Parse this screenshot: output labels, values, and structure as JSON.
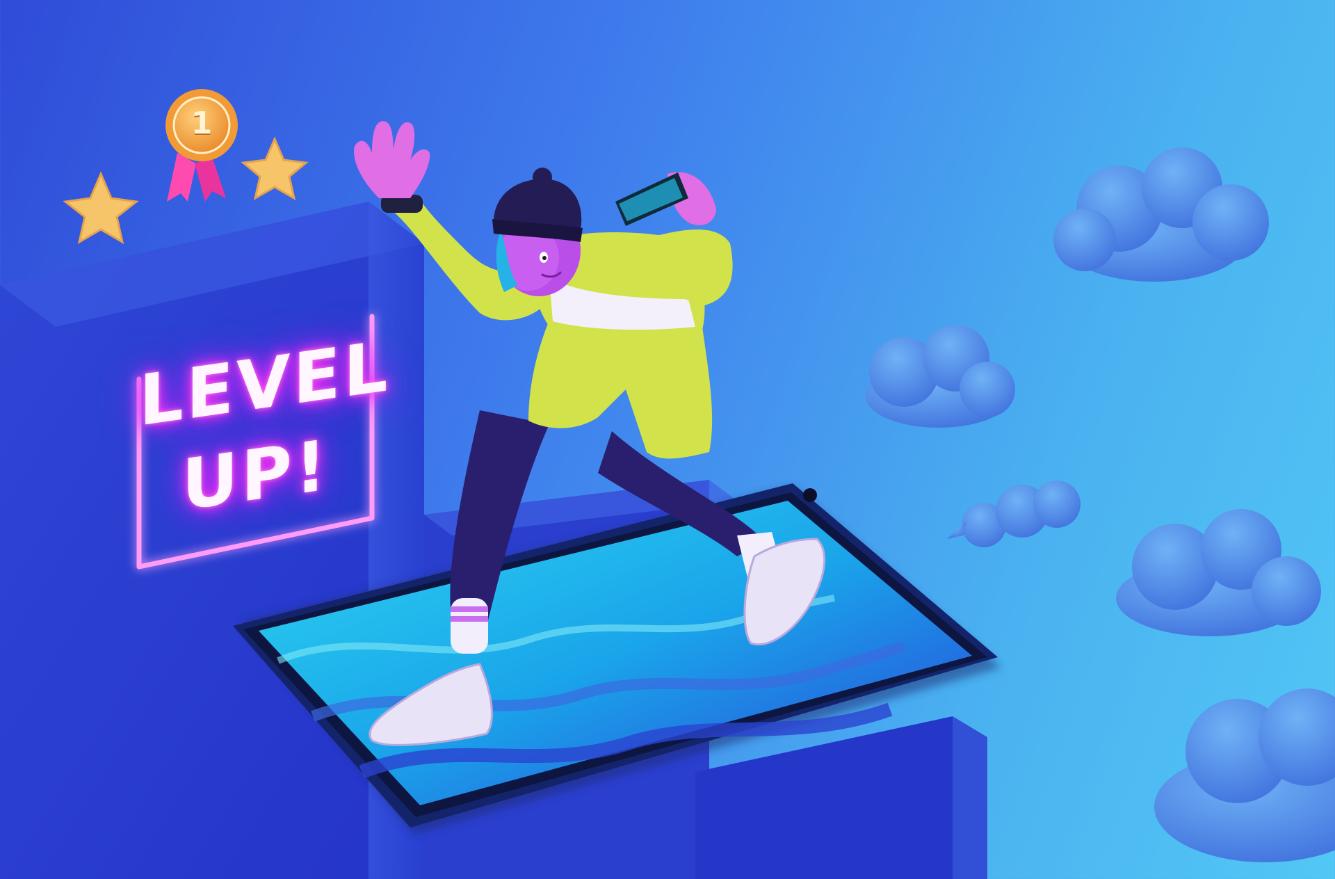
{
  "sign": {
    "line1": "LEVEL",
    "line2": "UP!"
  },
  "medal": {
    "number": "1"
  },
  "colors": {
    "background_left": "#2f4bd8",
    "background_right": "#52c7f5",
    "neon_pink": "#ff3ce8",
    "shirt_lime": "#d2e24a",
    "cloud_blue": "#4f8fe6",
    "screen_cyan": "#26c7ee"
  }
}
